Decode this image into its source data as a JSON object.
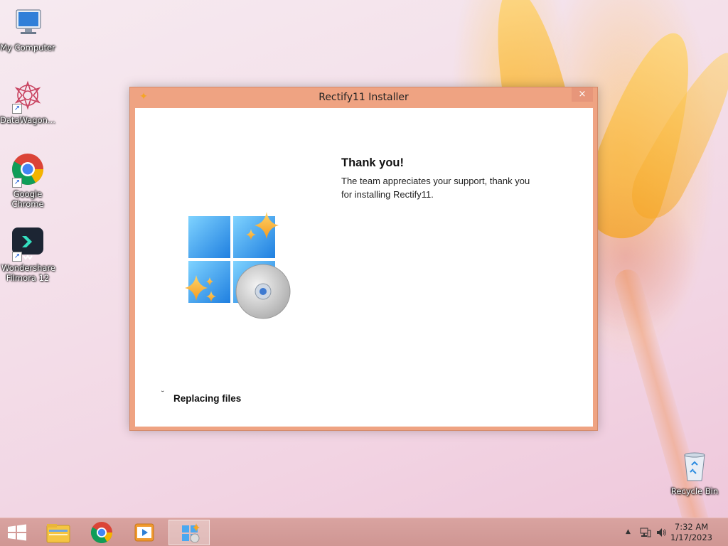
{
  "desktop": {
    "icons": [
      {
        "label": "My Computer",
        "icon": "computer-icon"
      },
      {
        "label": "DataWagon...",
        "icon": "datawagon-icon"
      },
      {
        "label": "Google Chrome",
        "icon": "chrome-icon"
      },
      {
        "label": "Wondershare Filmora 12",
        "icon": "filmora-icon"
      }
    ],
    "recycle_bin": {
      "label": "Recycle Bin",
      "icon": "recycle-bin-icon"
    }
  },
  "window": {
    "title": "Rectify11 Installer",
    "close_label": "×",
    "heading": "Thank you!",
    "message": "The team appreciates your support, thank you for installing Rectify11.",
    "status": "Replacing files",
    "logo_icon": "rectify11-logo-icon"
  },
  "taskbar": {
    "start_icon": "windows-start-icon",
    "pinned": [
      {
        "icon": "file-explorer-icon"
      },
      {
        "icon": "chrome-icon"
      },
      {
        "icon": "media-player-icon"
      },
      {
        "icon": "rectify11-installer-icon",
        "active": true
      }
    ],
    "clock": {
      "time": "7:32 AM",
      "date": "1/17/2023"
    }
  },
  "colors": {
    "window_frame": "#efa382",
    "taskbar": "#d59c99",
    "accent_star": "#f5a524",
    "logo_blue": "#2d8fe8"
  }
}
